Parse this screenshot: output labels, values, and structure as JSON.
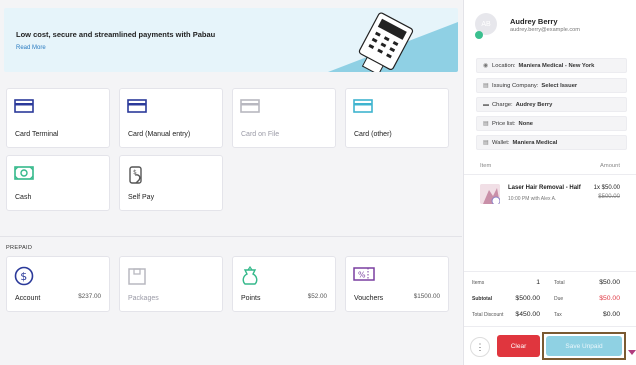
{
  "banner": {
    "title": "Low cost, secure and streamlined payments with Pabau",
    "link": "Read More"
  },
  "payment_methods": [
    {
      "label": "Card Terminal",
      "icon": "card-terminal-icon",
      "color": "#2b3a9a",
      "disabled": false
    },
    {
      "label": "Card (Manual entry)",
      "icon": "card-manual-icon",
      "color": "#2b3a9a",
      "disabled": false
    },
    {
      "label": "Card on File",
      "icon": "card-on-file-icon",
      "color": "#b8b8c0",
      "disabled": true
    },
    {
      "label": "Card (other)",
      "icon": "card-other-icon",
      "color": "#3fb4cf",
      "disabled": false
    },
    {
      "label": "Cash",
      "icon": "cash-icon",
      "color": "#35b98b",
      "disabled": false
    },
    {
      "label": "Self Pay",
      "icon": "self-pay-icon",
      "color": "#555",
      "disabled": false
    }
  ],
  "prepaid": {
    "section_label": "PREPAID",
    "items": [
      {
        "label": "Account",
        "amount": "$237.00",
        "icon": "account-dollar-icon",
        "color": "#2b3a9a"
      },
      {
        "label": "Packages",
        "amount": "",
        "icon": "packages-icon",
        "color": "#b8b8c0"
      },
      {
        "label": "Points",
        "amount": "$52.00",
        "icon": "points-icon",
        "color": "#35b98b"
      },
      {
        "label": "Vouchers",
        "amount": "$1500.00",
        "icon": "vouchers-icon",
        "color": "#7a3fa0"
      }
    ]
  },
  "client": {
    "initials": "AB",
    "name": "Audrey Berry",
    "email": "audrey.berry@example.com"
  },
  "info_rows": [
    {
      "icon": "location-icon",
      "label": "Location:",
      "value": "Maniera Medical - New York"
    },
    {
      "icon": "company-icon",
      "label": "Issuing Company:",
      "value": "Select Issuer"
    },
    {
      "icon": "charge-icon",
      "label": "Charge:",
      "value": "Audrey Berry"
    },
    {
      "icon": "price-list-icon",
      "label": "Price list:",
      "value": "None"
    },
    {
      "icon": "wallet-icon",
      "label": "Wallet:",
      "value": "Maniera Medical"
    }
  ],
  "columns": {
    "item": "Item",
    "amount": "Amount"
  },
  "line_item": {
    "name": "Laser Hair Removal - Half",
    "subtitle": "10:00 PM with Alex A.",
    "qty_price": "1x $50.00",
    "old_price": "$500.00"
  },
  "totals": {
    "items_label": "Items",
    "items_value": "1",
    "total_label": "Total",
    "total_value": "$50.00",
    "subtotal_label": "Subtotal",
    "subtotal_value": "$500.00",
    "due_label": "Due",
    "due_value": "$50.00",
    "discount_label": "Total Discount",
    "discount_value": "$450.00",
    "tax_label": "Tax",
    "tax_value": "$0.00"
  },
  "actions": {
    "more": "⋮",
    "clear": "Clear",
    "save": "Save Unpaid"
  }
}
